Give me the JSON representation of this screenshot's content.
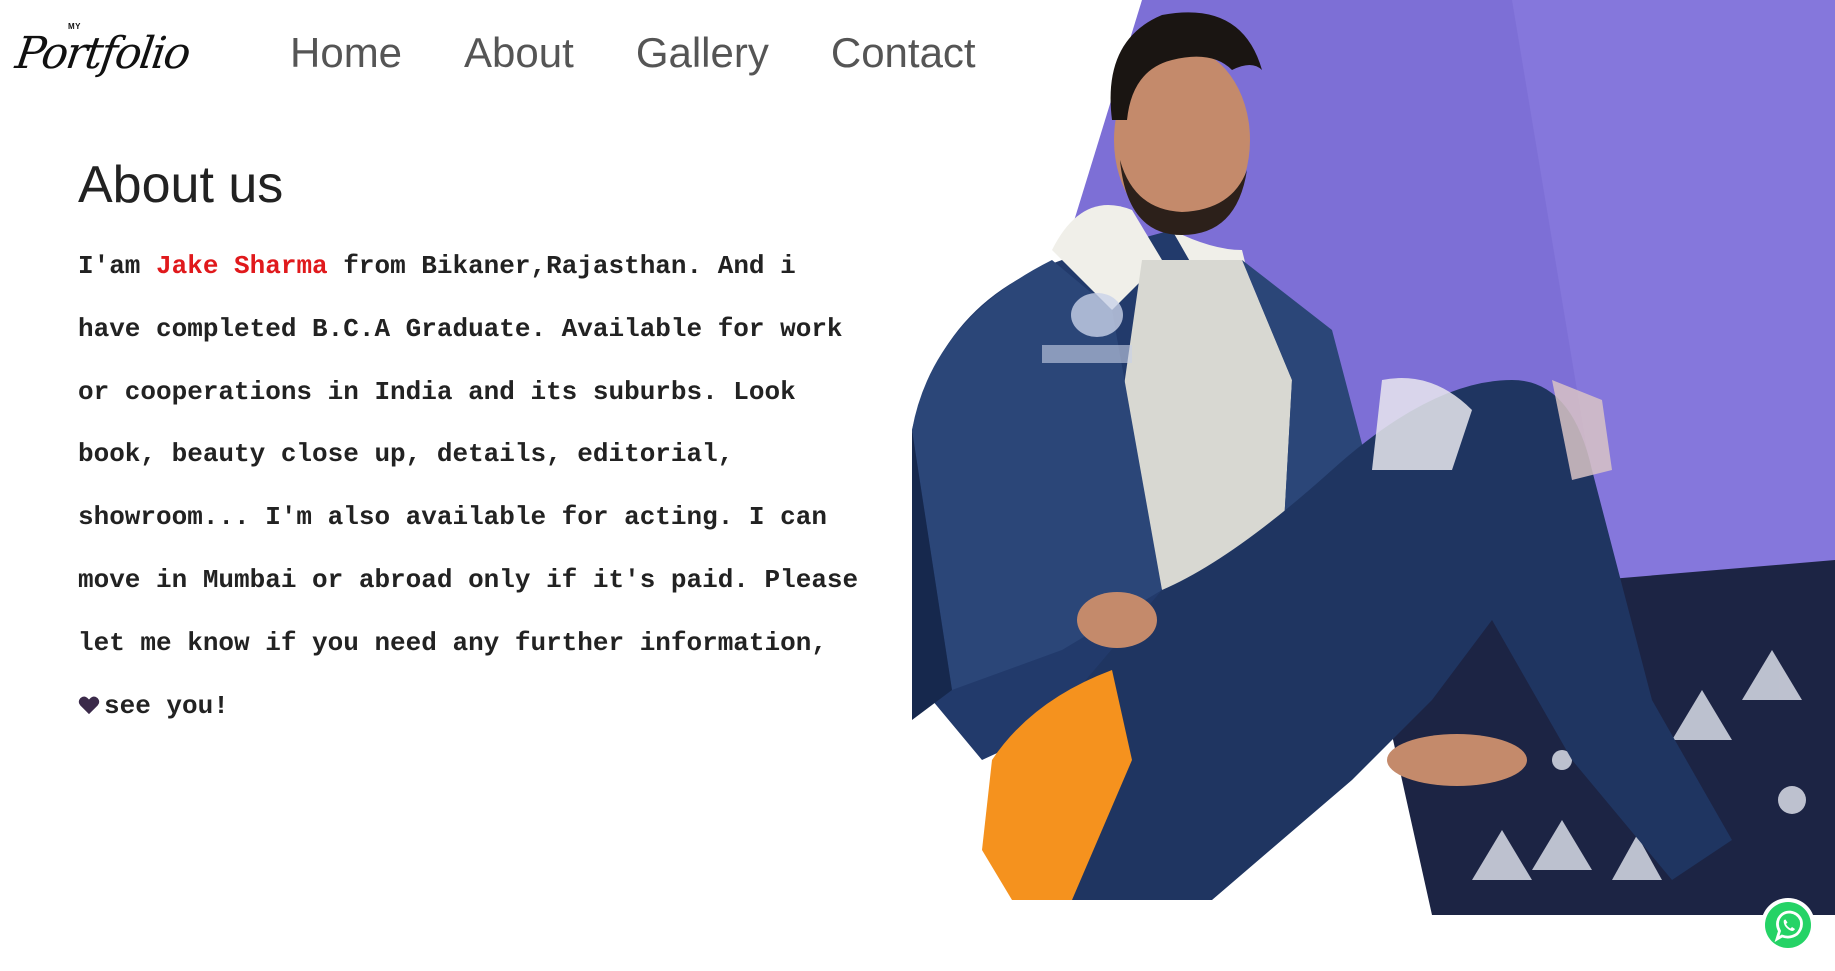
{
  "header": {
    "logo": {
      "small_text": "MY",
      "script_text": "Portfolio"
    },
    "nav": [
      {
        "label": "Home"
      },
      {
        "label": "About"
      },
      {
        "label": "Gallery"
      },
      {
        "label": "Contact"
      }
    ]
  },
  "about": {
    "title": "About us",
    "paragraph": {
      "lead": "I'am ",
      "name": "Jake Sharma",
      "body": " from Bikaner,Rajasthan. And i have completed B.C.A Graduate. Available for work or cooperations in India and its suburbs. Look book, beauty close up, details, editorial, showroom... I'm also available for acting. I can move in Mumbai or abroad only if it's paid. Please let me know if you need any further information, ",
      "heart_icon": "purple-heart-icon",
      "closing": "see you!"
    }
  },
  "hero": {
    "image_icon": "portrait-photo-icon"
  },
  "whatsapp": {
    "icon": "whatsapp-icon"
  },
  "colors": {
    "name_accent": "#e0191c",
    "nav_text": "#555555",
    "whatsapp_green": "#25d366",
    "wall_purple": "#7d6fd6",
    "heart_purple": "#3b2a4a"
  }
}
